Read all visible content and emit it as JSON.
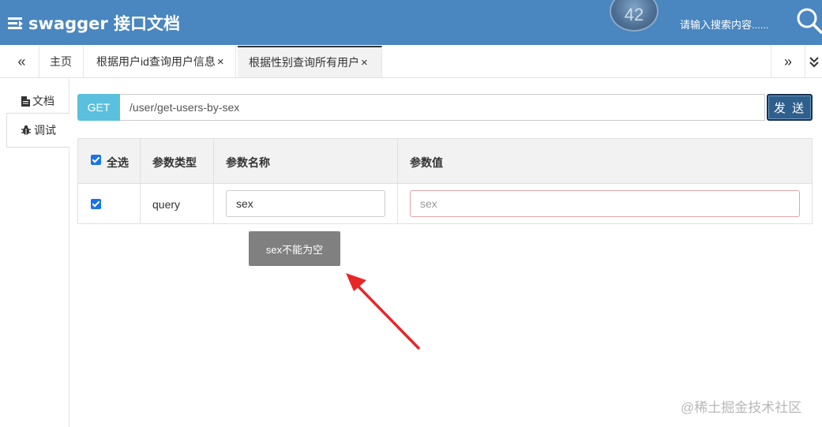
{
  "header": {
    "title": "swagger 接口文档",
    "badge_text": "42",
    "search_placeholder": "请输入搜索内容......"
  },
  "tabs": {
    "items": [
      {
        "label": "主页",
        "closable": false,
        "active": false
      },
      {
        "label": "根据用户id查询用户信息",
        "closable": true,
        "active": false
      },
      {
        "label": "根据性别查询所有用户",
        "closable": true,
        "active": true
      }
    ],
    "close_glyph": "×"
  },
  "side_tabs": [
    {
      "label": "文档",
      "icon": "document-icon",
      "active": false
    },
    {
      "label": "调试",
      "icon": "bug-icon",
      "active": true
    }
  ],
  "request": {
    "method": "GET",
    "url": "/user/get-users-by-sex",
    "send_label": "发 送"
  },
  "params_table": {
    "headers": {
      "select_all": "全选",
      "type": "参数类型",
      "name": "参数名称",
      "value": "参数值"
    },
    "rows": [
      {
        "checked": true,
        "type": "query",
        "name": "sex",
        "value_placeholder": "sex"
      }
    ]
  },
  "validation_tooltip": "sex不能为空",
  "watermark": "@稀土掘金技术社区",
  "colors": {
    "header": "#4a86bf",
    "method_badge": "#5bc0de",
    "send_button": "#2f5f8c",
    "tooltip": "#808080",
    "arrow": "#e8262a"
  }
}
